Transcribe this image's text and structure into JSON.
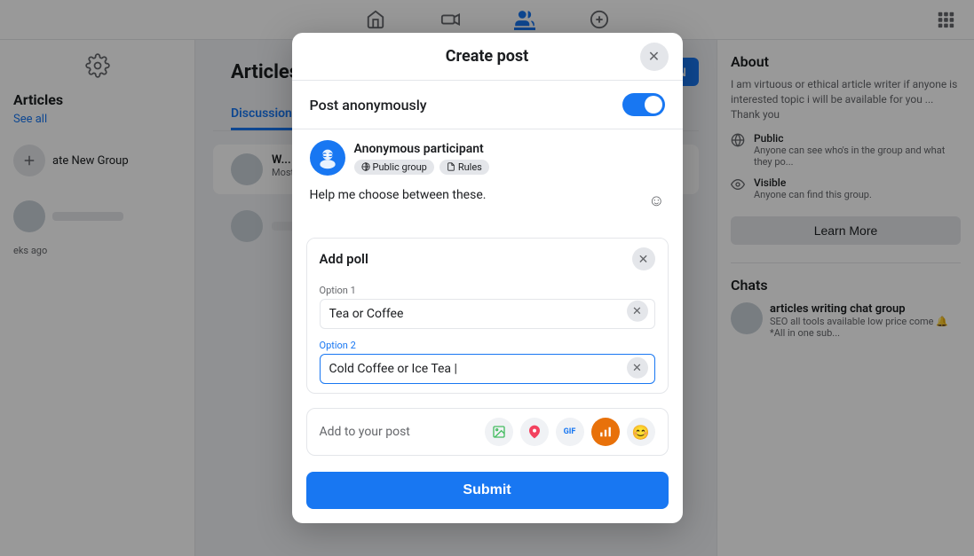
{
  "app": {
    "title": "Create post"
  },
  "topnav": {
    "icons": [
      "home",
      "video",
      "people",
      "add-circle",
      "grid"
    ]
  },
  "modal": {
    "title": "Create post",
    "close_label": "✕",
    "anon_label": "Post anonymously",
    "toggle_on": true,
    "user": {
      "name": "Anonymous participant",
      "avatar_emoji": "🕵️",
      "tag_group": "Public group",
      "tag_rules": "Rules"
    },
    "textarea_placeholder": "Help me choose between these.",
    "poll": {
      "title": "Add poll",
      "option1_label": "Option 1",
      "option1_value": "Tea or Coffee",
      "option2_label": "Option 2",
      "option2_value": "Cold Coffee or Ice Tea |"
    },
    "add_to_post_label": "Add to your post",
    "submit_label": "Submit"
  },
  "right_panel": {
    "about_title": "About",
    "about_desc": "I am virtuous or ethical article writer if anyone is interested topic i will be available for you ... Thank you",
    "public_label": "Public",
    "public_desc": "Anyone can see who's in the group and what they po...",
    "visible_label": "Visible",
    "visible_desc": "Anyone can find this group.",
    "learn_more": "Learn More",
    "chats_title": "Chats",
    "chat_name": "articles writing chat group",
    "chat_preview": "SEO all tools available low price come 🔔 *All in one sub..."
  },
  "left_sidebar": {
    "articles_title": "Articles",
    "see_all": "See all",
    "create_group": "ate New Group"
  },
  "tabs": {
    "discussion": "Discussion",
    "most_relevant": "Most relev..."
  }
}
